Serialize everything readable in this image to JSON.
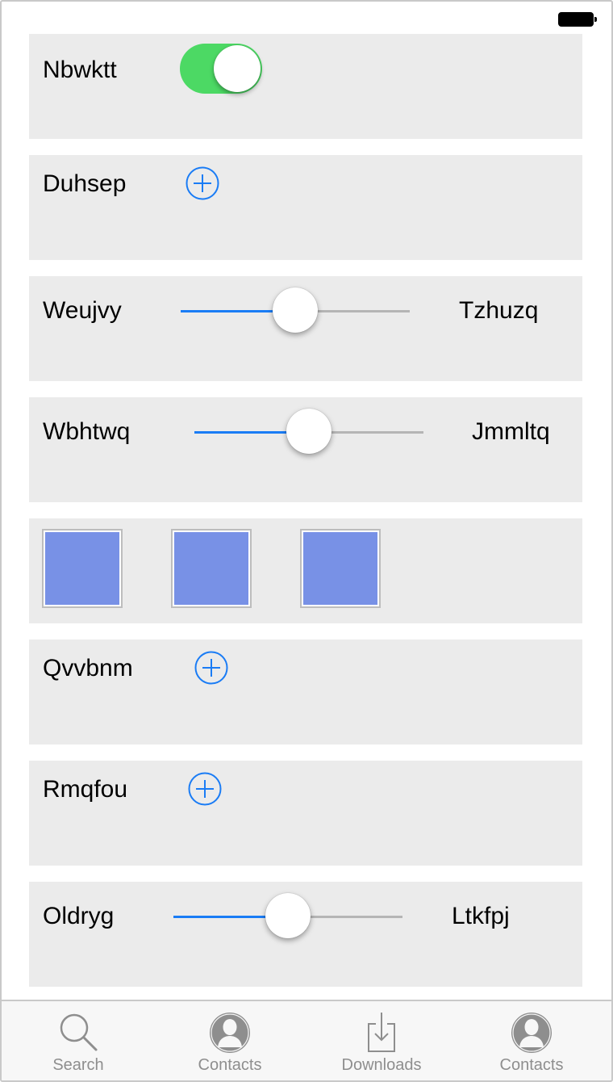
{
  "status_bar": {
    "battery_icon": "battery-icon"
  },
  "rows": [
    {
      "kind": "toggle",
      "label": "Nbwktt",
      "on": true,
      "on_color": "#4cd964"
    },
    {
      "kind": "add",
      "label": "Duhsep",
      "icon": "plus-circle-icon"
    },
    {
      "kind": "slider",
      "label": "Weujvy",
      "value": 0.5,
      "right_label": "Tzhuzq"
    },
    {
      "kind": "slider",
      "label": "Wbhtwq",
      "value": 0.5,
      "right_label": "Jmmltq"
    },
    {
      "kind": "swatches",
      "count": 3,
      "color": "#7891e6"
    },
    {
      "kind": "add",
      "label": "Qvvbnm",
      "icon": "plus-circle-icon"
    },
    {
      "kind": "add",
      "label": "Rmqfou",
      "icon": "plus-circle-icon"
    },
    {
      "kind": "slider",
      "label": "Oldryg",
      "value": 0.5,
      "right_label": "Ltkfpj"
    }
  ],
  "tab_bar": {
    "items": [
      {
        "label": "Search",
        "icon": "search-icon"
      },
      {
        "label": "Contacts",
        "icon": "contact-icon"
      },
      {
        "label": "Downloads",
        "icon": "download-icon"
      },
      {
        "label": "Contacts",
        "icon": "contact-icon"
      }
    ]
  },
  "colors": {
    "accent": "#1a7cf5",
    "card_bg": "#ebebeb",
    "tab_label": "#8e8e8e"
  }
}
